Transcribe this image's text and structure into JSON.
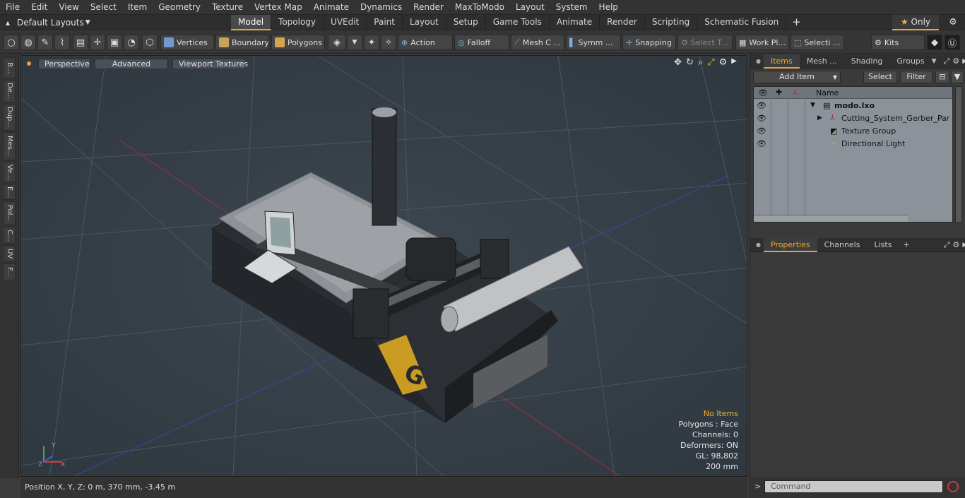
{
  "menu": [
    "File",
    "Edit",
    "View",
    "Select",
    "Item",
    "Geometry",
    "Texture",
    "Vertex Map",
    "Animate",
    "Dynamics",
    "Render",
    "MaxToModo",
    "Layout",
    "System",
    "Help"
  ],
  "layouts": {
    "label": "Default Layouts"
  },
  "tabs": [
    {
      "label": "Model",
      "active": true
    },
    {
      "label": "Topology"
    },
    {
      "label": "UVEdit"
    },
    {
      "label": "Paint"
    },
    {
      "label": "Layout"
    },
    {
      "label": "Setup"
    },
    {
      "label": "Game Tools"
    },
    {
      "label": "Animate"
    },
    {
      "label": "Render"
    },
    {
      "label": "Scripting"
    },
    {
      "label": "Schematic Fusion"
    }
  ],
  "only_label": "Only",
  "toolbar": {
    "vertices": "Vertices",
    "boundary": "Boundary",
    "polygons": "Polygons",
    "action": "Action",
    "falloff": "Falloff",
    "mesh": "Mesh C ...",
    "symm": "Symm ...",
    "snapping": "Snapping",
    "select_t": "Select T...",
    "work": "Work Pl...",
    "selecti": "Selecti ...",
    "kits": "Kits"
  },
  "left_tabs": [
    "B...",
    "De...",
    "Dup...",
    "Mes...",
    "Ve...",
    "E...",
    "Pol...",
    "C...",
    "UV",
    "F..."
  ],
  "viewport": {
    "perspective": "Perspective",
    "advanced": "Advanced",
    "textures": "Viewport Textures",
    "info": {
      "items": "No Items",
      "polygons": "Polygons : Face",
      "channels": "Channels: 0",
      "deformers": "Deformers: ON",
      "gl": "GL: 98,802",
      "scale": "200 mm"
    },
    "axis": {
      "x": "X",
      "y": "Y",
      "z": "Z"
    }
  },
  "status": "Position X, Y, Z:   0 m, 370 mm, -3.45 m",
  "items_panel": {
    "tabs": [
      "Items",
      "Mesh ...",
      "Shading",
      "Groups"
    ],
    "add_item": "Add Item",
    "select": "Select",
    "filter": "Filter",
    "column_name": "Name",
    "rows": [
      {
        "label": "modo.lxo",
        "bold": true
      },
      {
        "label": "Cutting_System_Gerber_Par ..."
      },
      {
        "label": "Texture Group"
      },
      {
        "label": "Directional Light"
      }
    ]
  },
  "props_panel": {
    "tabs": [
      "Properties",
      "Channels",
      "Lists"
    ]
  },
  "command_placeholder": "Command"
}
